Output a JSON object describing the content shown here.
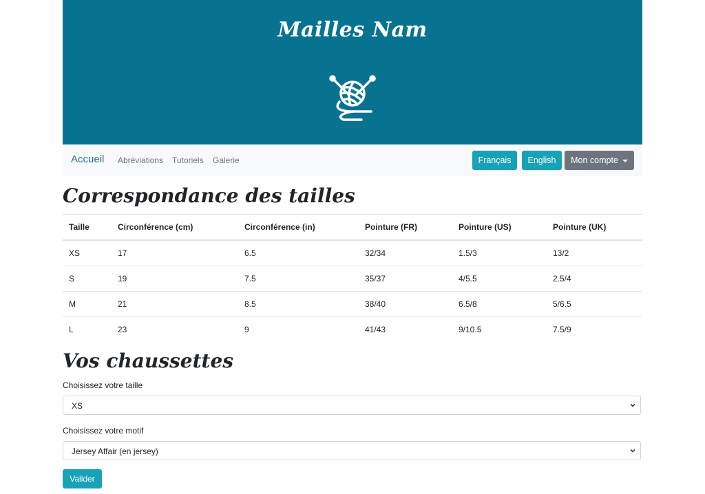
{
  "header": {
    "brand": "Mailles Nam",
    "logo_icon": "yarn-ball-needles-icon"
  },
  "nav": {
    "home": "Accueil",
    "links": [
      "Abréviations",
      "Tutoriels",
      "Galerie"
    ],
    "lang_fr": "Français",
    "lang_en": "English",
    "account": "Mon compte"
  },
  "sizes_section": {
    "title": "Correspondance des tailles",
    "columns": [
      "Taille",
      "Circonférence (cm)",
      "Circonférence (in)",
      "Pointure (FR)",
      "Pointure (US)",
      "Pointure (UK)"
    ],
    "rows": [
      [
        "XS",
        "17",
        "6.5",
        "32/34",
        "1.5/3",
        "13/2"
      ],
      [
        "S",
        "19",
        "7.5",
        "35/37",
        "4/5.5",
        "2.5/4"
      ],
      [
        "M",
        "21",
        "8.5",
        "38/40",
        "6.5/8",
        "5/6.5"
      ],
      [
        "L",
        "23",
        "9",
        "41/43",
        "9/10.5",
        "7.5/9"
      ]
    ]
  },
  "socks_section": {
    "title": "Vos chaussettes",
    "size_label": "Choisissez votre taille",
    "size_value": "XS",
    "pattern_label": "Choisissez votre motif",
    "pattern_value": "Jersey Affair (en jersey)",
    "submit": "Valider"
  },
  "colors": {
    "banner": "#087390",
    "info": "#17a2b8",
    "secondary": "#6c757d"
  }
}
